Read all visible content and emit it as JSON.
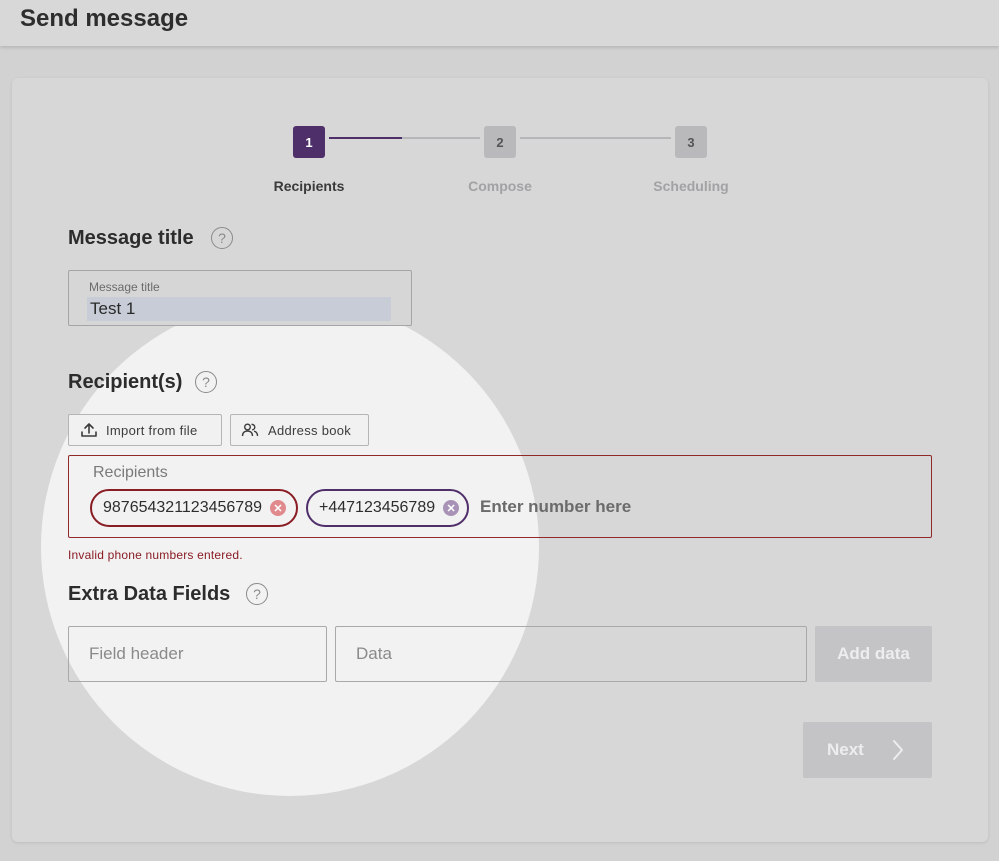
{
  "header": {
    "title": "Send message"
  },
  "stepper": {
    "steps": [
      {
        "number": "1",
        "label": "Recipients"
      },
      {
        "number": "2",
        "label": "Compose"
      },
      {
        "number": "3",
        "label": "Scheduling"
      }
    ]
  },
  "message_title": {
    "heading": "Message title",
    "help": "?",
    "field_label": "Message title",
    "value": "Test 1"
  },
  "recipients": {
    "heading": "Recipient(s)",
    "help": "?",
    "import_label": "Import from file",
    "address_book_label": "Address book",
    "field_label": "Recipients",
    "chips": [
      "987654321123456789",
      "+447123456789"
    ],
    "input_placeholder": "Enter number here",
    "error": "Invalid phone numbers entered."
  },
  "extra_fields": {
    "heading": "Extra Data Fields",
    "help": "?",
    "field_header_placeholder": "Field header",
    "data_placeholder": "Data",
    "add_label": "Add data"
  },
  "footer": {
    "next_label": "Next"
  },
  "colors": {
    "accent": "#4f2f6a",
    "error": "#8a1c24"
  }
}
